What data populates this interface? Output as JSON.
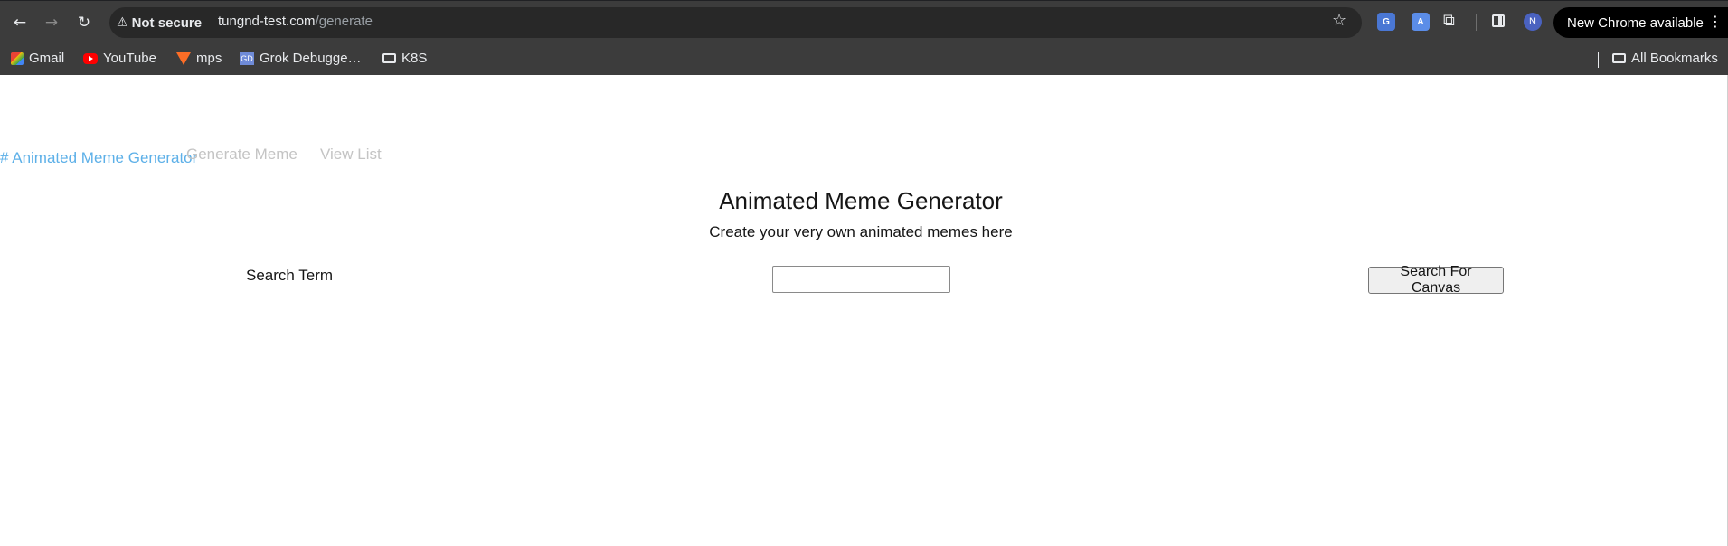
{
  "browser": {
    "nav": {
      "back_icon": "←",
      "forward_icon": "→",
      "reload_icon": "↻"
    },
    "security": {
      "icon": "⚠",
      "label": "Not secure"
    },
    "url": {
      "host": "tungnd-test.com",
      "path": "/generate"
    },
    "star_icon": "☆",
    "extensions": [
      {
        "name": "google-translate",
        "glyph": "G"
      },
      {
        "name": "translate",
        "glyph": "A"
      }
    ],
    "puzzle_icon": "⧉",
    "avatar_letter": "N",
    "update_label": "New Chrome available",
    "menu_icon": "⋮"
  },
  "bookmarks": {
    "items": [
      {
        "label": "Gmail"
      },
      {
        "label": "YouTube"
      },
      {
        "label": "mps"
      },
      {
        "label": "Grok Debugge…",
        "icon_text": "GD"
      },
      {
        "label": "K8S"
      }
    ],
    "all_label": "All Bookmarks"
  },
  "app": {
    "brand": "# Animated Meme Generator",
    "nav": [
      "Generate Meme",
      "View List"
    ],
    "title": "Animated Meme Generator",
    "subtitle": "Create your very own animated memes here",
    "search_label": "Search Term",
    "search_value": "",
    "search_button": "Search For Canvas"
  },
  "colors": {
    "chrome_bg": "#3c3c3c",
    "brand_link": "#5db0e8",
    "nav_link": "#c4c4c4"
  }
}
